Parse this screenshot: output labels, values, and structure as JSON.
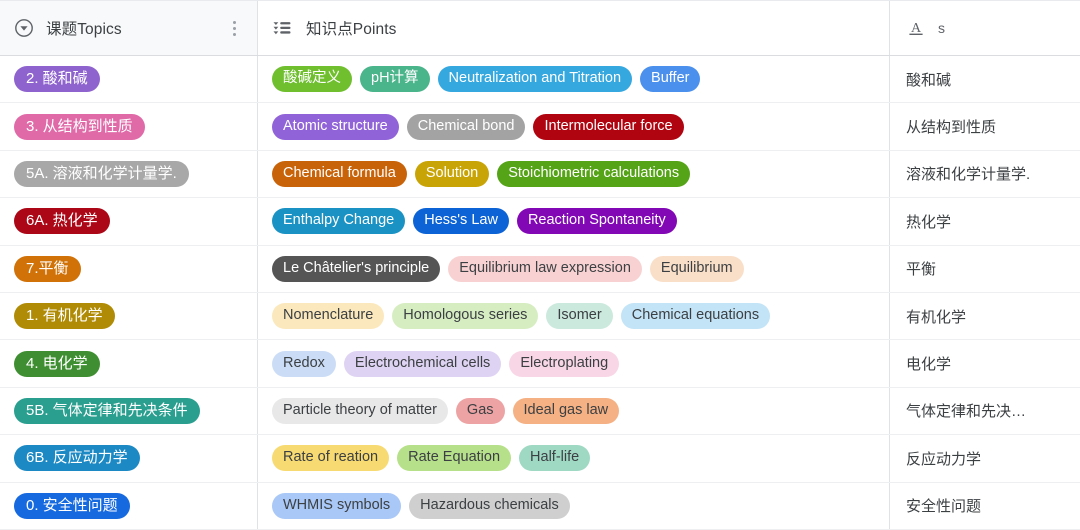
{
  "header": {
    "columns": [
      {
        "id": "topics",
        "label": "课题Topics",
        "icon": "circle-caret-down-icon",
        "menu_icon": "kebab-menu-icon"
      },
      {
        "id": "points",
        "label": "知识点Points",
        "icon": "multi-select-list-icon"
      },
      {
        "id": "text",
        "label": "s",
        "icon": "underlined-a-text-icon"
      }
    ]
  },
  "rows": [
    {
      "topic": {
        "label": "2. 酸和碱",
        "bg": "#8e63ce",
        "fg": "#ffffff"
      },
      "points": [
        {
          "label": "酸碱定义",
          "bg": "#6fbf2f",
          "fg": "#ffffff"
        },
        {
          "label": "pH计算",
          "bg": "#4ab48b",
          "fg": "#ffffff"
        },
        {
          "label": "Neutralization and Titration",
          "bg": "#36a8e0",
          "fg": "#ffffff"
        },
        {
          "label": "Buffer",
          "bg": "#4a90ec",
          "fg": "#ffffff"
        }
      ],
      "text": "酸和碱"
    },
    {
      "topic": {
        "label": "3. 从结构到性质",
        "bg": "#e06aa8",
        "fg": "#ffffff"
      },
      "points": [
        {
          "label": "Atomic structure",
          "bg": "#9163d8",
          "fg": "#ffffff"
        },
        {
          "label": "Chemical bond",
          "bg": "#a3a3a3",
          "fg": "#ffffff"
        },
        {
          "label": "Intermolecular force",
          "bg": "#b00510",
          "fg": "#ffffff"
        }
      ],
      "text": "从结构到性质"
    },
    {
      "topic": {
        "label": "5A. 溶液和化学计量学.",
        "bg": "#a8a8a8",
        "fg": "#ffffff"
      },
      "points": [
        {
          "label": "Chemical formula",
          "bg": "#c96309",
          "fg": "#ffffff"
        },
        {
          "label": "Solution",
          "bg": "#c9a406",
          "fg": "#ffffff"
        },
        {
          "label": "Stoichiometric calculations",
          "bg": "#55a316",
          "fg": "#ffffff"
        }
      ],
      "text": "溶液和化学计量学."
    },
    {
      "topic": {
        "label": "6A. 热化学",
        "bg": "#ab0716",
        "fg": "#ffffff"
      },
      "points": [
        {
          "label": "Enthalpy Change",
          "bg": "#1b92c4",
          "fg": "#ffffff"
        },
        {
          "label": "Hess's Law",
          "bg": "#0b63d6",
          "fg": "#ffffff"
        },
        {
          "label": "Reaction Spontaneity",
          "bg": "#8207b5",
          "fg": "#ffffff"
        }
      ],
      "text": "热化学"
    },
    {
      "topic": {
        "label": "7.平衡",
        "bg": "#d07208",
        "fg": "#ffffff"
      },
      "points": [
        {
          "label": "Le Châtelier's principle",
          "bg": "#555555",
          "fg": "#ffffff"
        },
        {
          "label": "Equilibrium law expression",
          "bg": "#f8d2d2",
          "fg": "#3c4043"
        },
        {
          "label": "Equilibrium",
          "bg": "#fadfc8",
          "fg": "#3c4043"
        }
      ],
      "text": "平衡"
    },
    {
      "topic": {
        "label": "1. 有机化学",
        "bg": "#b08b05",
        "fg": "#ffffff"
      },
      "points": [
        {
          "label": "Nomenclature",
          "bg": "#fbe8bc",
          "fg": "#3c4043"
        },
        {
          "label": "Homologous series",
          "bg": "#d6edc2",
          "fg": "#3c4043"
        },
        {
          "label": "Isomer",
          "bg": "#cbe9dd",
          "fg": "#3c4043"
        },
        {
          "label": "Chemical equations",
          "bg": "#c3e3f6",
          "fg": "#3c4043"
        }
      ],
      "text": "有机化学"
    },
    {
      "topic": {
        "label": "4. 电化学",
        "bg": "#3f8f32",
        "fg": "#ffffff"
      },
      "points": [
        {
          "label": "Redox",
          "bg": "#cbddf6",
          "fg": "#3c4043"
        },
        {
          "label": "Electrochemical cells",
          "bg": "#dfd3f3",
          "fg": "#3c4043"
        },
        {
          "label": "Electroplating",
          "bg": "#f8d6e6",
          "fg": "#3c4043"
        }
      ],
      "text": "电化学"
    },
    {
      "topic": {
        "label": "5B. 气体定律和先决条件",
        "bg": "#2a9f8f",
        "fg": "#ffffff"
      },
      "points": [
        {
          "label": "Particle theory of matter",
          "bg": "#e8e8e8",
          "fg": "#3c4043"
        },
        {
          "label": "Gas",
          "bg": "#eda3a4",
          "fg": "#3c4043"
        },
        {
          "label": "Ideal gas law",
          "bg": "#f5b183",
          "fg": "#3c4043"
        }
      ],
      "text": "气体定律和先决…"
    },
    {
      "topic": {
        "label": "6B. 反应动力学",
        "bg": "#1c89c4",
        "fg": "#ffffff"
      },
      "points": [
        {
          "label": "Rate of reation",
          "bg": "#f7da72",
          "fg": "#3c4043"
        },
        {
          "label": "Rate Equation",
          "bg": "#b7e08a",
          "fg": "#3c4043"
        },
        {
          "label": "Half-life",
          "bg": "#9fd9c4",
          "fg": "#3c4043"
        }
      ],
      "text": "反应动力学"
    },
    {
      "topic": {
        "label": "0. 安全性问题",
        "bg": "#1769e0",
        "fg": "#ffffff"
      },
      "points": [
        {
          "label": "WHMIS symbols",
          "bg": "#a9c8f7",
          "fg": "#3c4043"
        },
        {
          "label": "Hazardous chemicals",
          "bg": "#cfcfcf",
          "fg": "#3c4043"
        }
      ],
      "text": "安全性问题"
    }
  ]
}
